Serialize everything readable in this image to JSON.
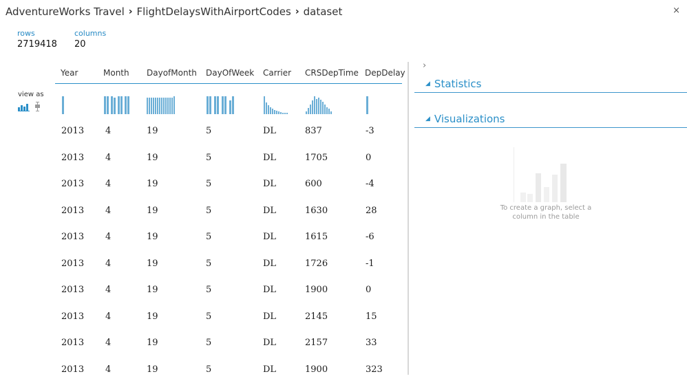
{
  "breadcrumb": {
    "items": [
      "AdventureWorks Travel",
      "FlightDelaysWithAirportCodes",
      "dataset"
    ],
    "separator": "›"
  },
  "close": "×",
  "summary": {
    "rows_label": "rows",
    "rows_value": "2719418",
    "columns_label": "columns",
    "columns_value": "20"
  },
  "view_as": {
    "label": "view as",
    "icons": [
      "histogram-icon",
      "boxplot-icon"
    ]
  },
  "table": {
    "columns": [
      "Year",
      "Month",
      "DayofMonth",
      "DayOfWeek",
      "Carrier",
      "CRSDepTime",
      "DepDelay"
    ],
    "rows": [
      [
        "2013",
        "4",
        "19",
        "5",
        "DL",
        "837",
        "-3"
      ],
      [
        "2013",
        "4",
        "19",
        "5",
        "DL",
        "1705",
        "0"
      ],
      [
        "2013",
        "4",
        "19",
        "5",
        "DL",
        "600",
        "-4"
      ],
      [
        "2013",
        "4",
        "19",
        "5",
        "DL",
        "1630",
        "28"
      ],
      [
        "2013",
        "4",
        "19",
        "5",
        "DL",
        "1615",
        "-6"
      ],
      [
        "2013",
        "4",
        "19",
        "5",
        "DL",
        "1726",
        "-1"
      ],
      [
        "2013",
        "4",
        "19",
        "5",
        "DL",
        "1900",
        "0"
      ],
      [
        "2013",
        "4",
        "19",
        "5",
        "DL",
        "2145",
        "15"
      ],
      [
        "2013",
        "4",
        "19",
        "5",
        "DL",
        "2157",
        "33"
      ],
      [
        "2013",
        "4",
        "19",
        "5",
        "DL",
        "1900",
        "323"
      ]
    ]
  },
  "panel": {
    "expand": "›",
    "sections": [
      {
        "title": "Statistics",
        "expanded": true
      },
      {
        "title": "Visualizations",
        "expanded": true
      }
    ],
    "empty_message": "To create a graph, select a column in the table"
  },
  "colors": {
    "accent": "#2a8fc8",
    "histogram": "#6aaed6"
  }
}
